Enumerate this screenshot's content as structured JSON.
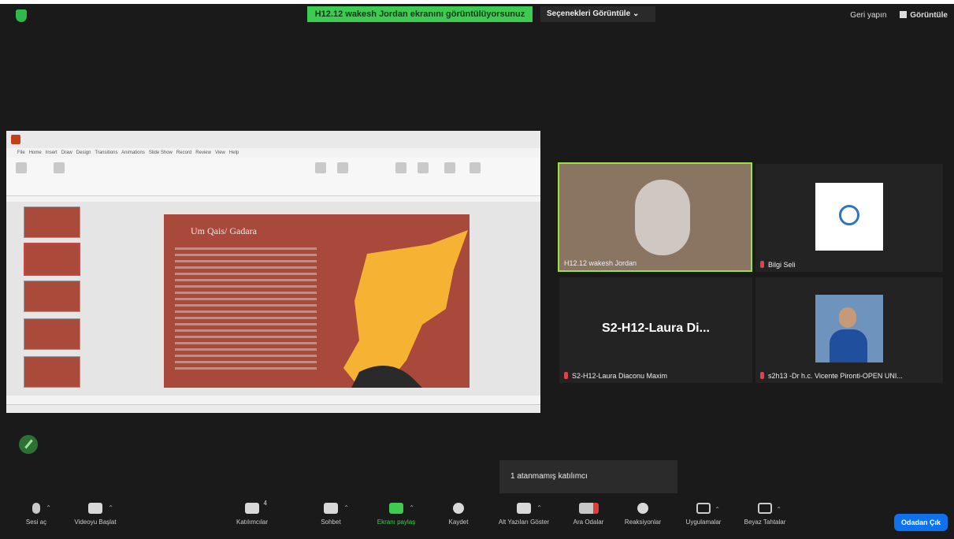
{
  "top": {
    "share_banner": "H12.12 wakesh Jordan ekranını görüntülüyorsunuz",
    "view_options": "Seçenekleri Görüntüle",
    "right_items": [
      "Geri yapın",
      "Görüntüle"
    ]
  },
  "slide": {
    "title": "Um Qais/ Gadara"
  },
  "ppt": {
    "tabs": [
      "File",
      "Home",
      "Insert",
      "Draw",
      "Design",
      "Transitions",
      "Animations",
      "Slide Show",
      "Record",
      "Review",
      "View",
      "Help"
    ]
  },
  "participants": [
    {
      "name": "H12.12 wakesh Jordan"
    },
    {
      "name": "Bilgi Seli"
    },
    {
      "name": "S2-H12-Laura Diaconu Maxim",
      "display": "S2-H12-Laura  Di..."
    },
    {
      "name": "s2h13 -Dr h.c. Vicente Pironti-OPEN UNI..."
    }
  ],
  "toast": "1 atanmamış katılımcı",
  "toolbar": [
    {
      "label": "Sesi aç",
      "icon": "mic-muted-icon"
    },
    {
      "label": "Videoyu Başlat",
      "icon": "video-off-icon"
    },
    {
      "label": "Katılımcılar",
      "icon": "participants-icon",
      "badge": "4"
    },
    {
      "label": "Sohbet",
      "icon": "chat-icon"
    },
    {
      "label": "Ekranı paylaş",
      "icon": "share-screen-icon"
    },
    {
      "label": "Kaydet",
      "icon": "record-icon"
    },
    {
      "label": "Alt Yazıları Göster",
      "icon": "captions-icon"
    },
    {
      "label": "Ara Odalar",
      "icon": "breakout-rooms-icon"
    },
    {
      "label": "Reaksiyonlar",
      "icon": "reactions-icon"
    },
    {
      "label": "Uygulamalar",
      "icon": "apps-icon"
    },
    {
      "label": "Beyaz Tahtalar",
      "icon": "whiteboard-icon"
    }
  ],
  "leave_label": "Odadan Çık",
  "colors": {
    "banner": "#3ecb52",
    "leave": "#0e72ed",
    "active_border": "#9be33b"
  }
}
